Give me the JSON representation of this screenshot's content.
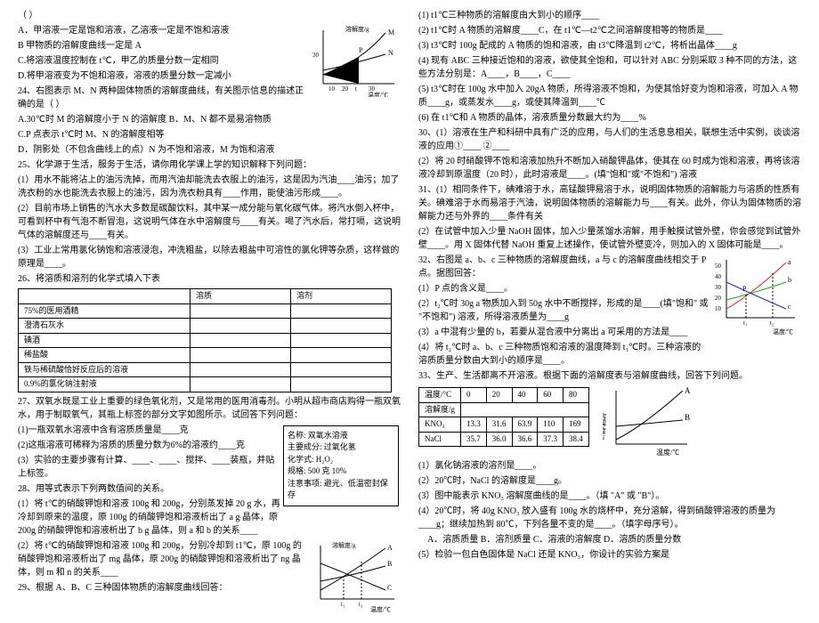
{
  "left": {
    "q_paren": "（    ）",
    "optA": "A．甲溶液一定是饱和溶液，乙溶液一定是不饱和溶液",
    "optB": "B 甲物质的溶解度曲线一定是 A",
    "optC": "C.将溶液温度控制在 t℃，甲乙的质量分数一定相同",
    "optD": "D.将甲溶液变为不饱和溶液，溶液的质量分数一定减小",
    "q24": "24、右图表示 M、N 两种固体物质的溶解度曲线，有关图示信息的描述正确的是（    ）",
    "q24A": "A.30℃时 M 的溶解度小于 N 的溶解度     B．M、N 都不是易溶物质",
    "q24C": "C.P 点表示 t℃时 M、N 的溶解度相等",
    "q24D": "D．阴影处（不包含曲线上的点）N 为不饱和溶液，M 为饱和溶液",
    "graph1": {
      "ylabel": "溶解度/g",
      "xlabel": "温度/℃",
      "t0": "0",
      "t1": "10",
      "t2": "20",
      "t3": "t",
      "t4": "30",
      "y30": "30",
      "M": "M",
      "N": "N",
      "P": "P"
    },
    "q25": "25、化学源于生活，服务于生活，请你用化学课上学的知识解释下列问题：",
    "q25_1": "(1）用水不能将沾上的油污洗掉，而用汽油却能洗去衣服上的油污，这是因为汽油____油污；加了洗衣粉的水也能洗去衣服上的油污，因为洗衣粉具有____作用，能使油污形成____。",
    "q25_2": "(2）目前市场上销售的汽水大多数是碳酸饮料，其中某一成分能与氧化碳气体。将汽水倒入杯中，可看到杯中有气泡不断冒泡，这说明气体在水中溶解度与____有关。喝了汽水后，常打嗝，这说明气体的溶解度还与____有关。",
    "q25_3": "(3）工业上常用氯化钠饱和溶液浸泡，冲洗粗盐，以除去粗盐中可溶性的氯化钾等杂质，这样做的原理是____。",
    "q26": "26、将溶质和溶剂的化学式填入下表",
    "tbl1": {
      "h1": "溶质",
      "h2": "溶剂",
      "r1": "75%的医用酒精",
      "r2": "澄清石灰水",
      "r3": "碘酒",
      "r4": "稀盐酸",
      "r5": "铁与稀硫酸恰好反应后的溶液",
      "r6": "0.9%的氯化钠注射液"
    },
    "q27": "27、双氧水既是工业上重要的绿色氧化剂，又是常用的医用消毒剂。小明从超市商店购得一瓶双氧水，用于制取氧气，其瓶上标签的部分文字如图所示。试回答下列问题：",
    "q27_1": "(1)一瓶双氧水溶液中含有溶质质量是____克",
    "q27_2": "(2)这瓶溶液可稀释为溶质的质量分数为6%的溶液约____克",
    "q27_3": "(3）实验的主要步骤有计算、____、____、搅拌、____装瓶，并贴上标签。",
    "label": {
      "l1": "名称: 双氧水溶液",
      "l2": "主要成分: 过氧化氢",
      "l3": "化学式: H₂O₂",
      "l4": "规格: 500 克 10%",
      "l5": "注意事项: 避光、低温密封保存"
    },
    "q28": "28、用等式表示下列两数值间的关系。",
    "q28_1": "(1）将 t℃的硝酸钾饱和溶液 100g 和 200g，分别蒸发掉 20 g 水，再冷却到原来的温度，原 100g 的硝酸钾饱和溶液析出了 a g 晶体，原 200g 的硝酸钾饱和溶液析出了 b g 晶体，则 a 和 b 的关系____",
    "q28_2": "(2）将 t℃的硝酸钾饱和溶液 100g 和 200g，分别冷却到 t1℃，原 100g 的硝酸钾饱和溶液析出了 mg 晶体，原 200g 的硝酸钾饱和溶液析出了 ng 晶体，则 m 和 n 的关系____",
    "q29": "29、根据 A、B、C 三种固体物质的溶解度曲线回答：",
    "graph2": {
      "ylabel": "溶解度/g",
      "xlabel": "温度/℃",
      "A": "A",
      "B": "B",
      "C": "C",
      "t1": "t₁",
      "t2": "t₂"
    }
  },
  "right": {
    "r1": "(1) t1℃三种物质的溶解度由大到小的顺序____",
    "r2": "(2) t1℃时 A 物质的溶解度____C，在 t1℃—t2℃之间溶解度相等的物质是____",
    "r3": "(3) t3℃时 100g 配成的 A 物质的饱和溶液，由 t3℃降温到 t2℃，将析出晶体____g",
    "r4": "(4) 现有 ABC 三种接近饱和的溶液，欲使其全饱和，可以针对 ABC 分别采取 3 种不同的方法，这些方法分别是：A____，B____，C____",
    "r5": "(5) t3℃时在 100g 水中加入 20gA 物质，所得溶液不饱和，为使其恰好变为饱和溶液，可加入 A 物质____g，或蒸发水____g，或使其降温到____℃",
    "r6": "(6) 在 t1℃和 A 物质的晶体，溶液质量分数最大约为____%",
    "q30": "30、(1）溶液在生产和科研中具有广泛的应用，与人们的生活息息相关，联想生活中实例，谈谈溶液的应用①____  ②____",
    "q30_2": "(2）将 20 时硝酸钾不饱和溶液加热升不断加入硝酸钾晶体，使其在 60 时成为饱和溶液，再将该溶液冷却到原温度（20 时），此时溶液是____。(填\"饱和\"或\"不饱和\") 溶液",
    "q31": "31、(1）相同条件下，碘难溶于水，高锰酸钾易溶于水，说明固体物质的溶解能力与溶质的性质有关。碘难溶于水而易溶于汽油，说明固体物质的溶解能力与____有关。此外，你认为固体物质的溶解能力还与外界的____条件有关",
    "q31_2": "(2）在试管中加入少量 NaOH 固体，加入少量蒸馏水溶解，用手触摸试管外壁，你会感觉到试管外壁____。用 X 固体代替 NaOH 重复上述操作，使试管外壁变冷，则加入的 X 固体可能是____。",
    "q32": "32、右图是 a、b、c 三种物质的溶解度曲线，a 与 c 的溶解度曲线相交于 P 点。据图回答：",
    "q32_1": "(1）P 点的含义是____。",
    "q32_2": "(2）t₂℃时 30g  a 物质加入到 50g 水中不断搅拌，形成的是____(填\"饱和\" 或 \"不饱和\") 溶液，所得溶液质量为____g",
    "q32_3": "(3）a 中混有少量的 b，若要从混合液中分离出 a 可采用的方法是____",
    "q32_4": "(4）将 t₂℃时 a、b、c 三种物质饱和溶液的温度降到 t₁℃时。三种溶液的溶质质量分数由大到小的顺序是____。",
    "graph3": {
      "ylabel": "溶解度/g",
      "xlabel": "温度/℃",
      "a": "a",
      "b": "b",
      "c": "c",
      "t1": "t₁",
      "t2": "t₂",
      "P": "P",
      "y10": "10",
      "y20": "20",
      "y30": "30",
      "y40": "40",
      "y50": "50"
    },
    "q33": "33、生产、生活都离不开溶液。根据下面的溶解度表与溶解度曲线，回答下列问题。",
    "tbl2": {
      "h0": "温度/°C",
      "h1": "0",
      "h2": "20",
      "h3": "40",
      "h4": "60",
      "h5": "80",
      "r1h": "溶解度/g",
      "r2h": "KNO₃",
      "r2c1": "13.3",
      "r2c2": "31.6",
      "r2c3": "63.9",
      "r2c4": "110",
      "r2c5": "169",
      "r3h": "NaCl",
      "r3c1": "35.7",
      "r3c2": "36.0",
      "r3c3": "36.6",
      "r3c4": "37.3",
      "r3c5": "38.4"
    },
    "q33_1": "(1）氯化钠溶液的溶剂是____。",
    "q33_2": "(2）20℃时，NaCl 的溶解度是____g。",
    "q33_3": "(3）图中能表示 KNO₃ 溶解度曲线的是____。（填 \"A\" 或 \"B\"）。",
    "q33_4": "(4）20℃时，将 40g  KNO₃ 放入盛有 100g 水的烧杯中，充分溶解，得到硝酸钾溶液的质量为____g；继续加热到 80℃，下列各量不变的是____。（填字母序号）。",
    "q33_4opts": "A．溶质质量   B．溶剂质量   C．溶液的溶解度   D．溶质的质量分数",
    "q33_5": "(5）检验一包白色固体是 NaCl 还是 KNO₃，你设计的实验方案是",
    "graph4": {
      "ylabel": "溶解度/g",
      "xlabel": "温度/℃",
      "A": "A",
      "B": "B"
    }
  }
}
